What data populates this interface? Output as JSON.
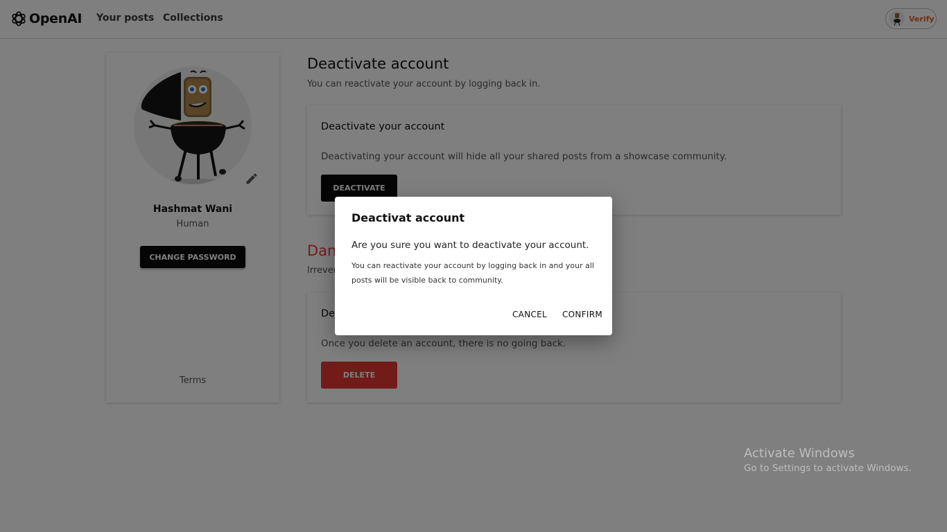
{
  "header": {
    "logo_text": "OpenAI",
    "nav": {
      "posts": "Your posts",
      "collections": "Collections"
    },
    "verify_label": "Verify"
  },
  "profile": {
    "name": "Hashmat Wani",
    "role": "Human",
    "change_password_label": "CHANGE PASSWORD",
    "terms_label": "Terms"
  },
  "deactivate_section": {
    "title": "Deactivate account",
    "subtitle": "You can reactivate your account by logging back in.",
    "card_title": "Deactivate your account",
    "card_text": "Deactivating your account will hide all your shared posts from a showcase community.",
    "button_label": "DEACTIVATE"
  },
  "danger_section": {
    "title": "Dan",
    "subtitle": "Irrever",
    "card_title": "De",
    "card_text": "Once you delete an account, there is no going back.",
    "button_label": "DELETE"
  },
  "dialog": {
    "title": "Deactivat account",
    "question": "Are you sure you want to deactivate your account.",
    "note": "You can reactivate your account by logging back in and your all posts will be visible back to community.",
    "cancel_label": "CANCEL",
    "confirm_label": "CONFIRM"
  },
  "watermark": {
    "title": "Activate Windows",
    "subtitle": "Go to Settings to activate Windows."
  },
  "colors": {
    "danger": "#e53935",
    "verify": "#e0602a",
    "primary_button": "#0a0a0a"
  }
}
